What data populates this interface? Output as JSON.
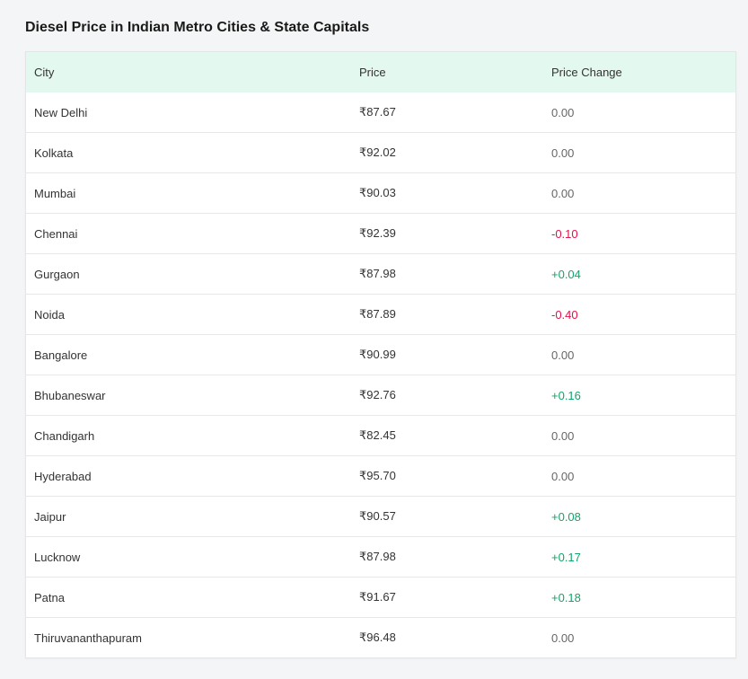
{
  "title": "Diesel Price in Indian Metro Cities & State Capitals",
  "columns": [
    "City",
    "Price",
    "Price Change"
  ],
  "rows": [
    {
      "city": "New Delhi",
      "price": "₹87.67",
      "change": "0.00",
      "trend": "zero"
    },
    {
      "city": "Kolkata",
      "price": "₹92.02",
      "change": "0.00",
      "trend": "zero"
    },
    {
      "city": "Mumbai",
      "price": "₹90.03",
      "change": "0.00",
      "trend": "zero"
    },
    {
      "city": "Chennai",
      "price": "₹92.39",
      "change": "-0.10",
      "trend": "neg"
    },
    {
      "city": "Gurgaon",
      "price": "₹87.98",
      "change": "+0.04",
      "trend": "pos"
    },
    {
      "city": "Noida",
      "price": "₹87.89",
      "change": "-0.40",
      "trend": "neg"
    },
    {
      "city": "Bangalore",
      "price": "₹90.99",
      "change": "0.00",
      "trend": "zero"
    },
    {
      "city": "Bhubaneswar",
      "price": "₹92.76",
      "change": "+0.16",
      "trend": "pos"
    },
    {
      "city": "Chandigarh",
      "price": "₹82.45",
      "change": "0.00",
      "trend": "zero"
    },
    {
      "city": "Hyderabad",
      "price": "₹95.70",
      "change": "0.00",
      "trend": "zero"
    },
    {
      "city": "Jaipur",
      "price": "₹90.57",
      "change": "+0.08",
      "trend": "pos"
    },
    {
      "city": "Lucknow",
      "price": "₹87.98",
      "change": "+0.17",
      "trend": "pos"
    },
    {
      "city": "Patna",
      "price": "₹91.67",
      "change": "+0.18",
      "trend": "pos"
    },
    {
      "city": "Thiruvananthapuram",
      "price": "₹96.48",
      "change": "0.00",
      "trend": "zero"
    }
  ],
  "colors": {
    "header_bg": "#e3f8ee",
    "positive": "#14a36a",
    "negative": "#e0114b",
    "neutral": "#666666"
  }
}
